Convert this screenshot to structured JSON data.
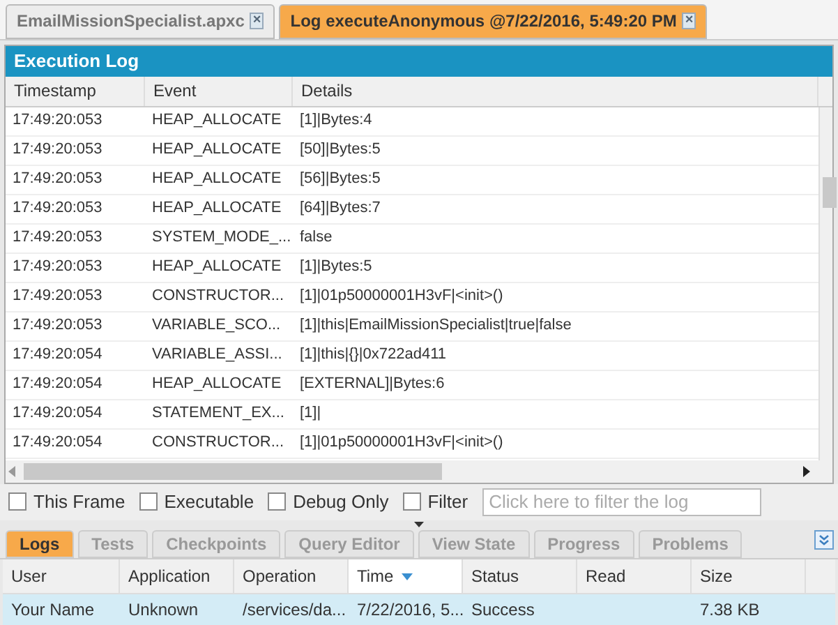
{
  "editor_tabs": [
    {
      "label": "EmailMissionSpecialist.apxc",
      "selected": false,
      "close": "×"
    },
    {
      "label": "Log executeAnonymous @7/22/2016, 5:49:20 PM",
      "selected": true,
      "close": "×"
    }
  ],
  "panel": {
    "title": "Execution Log"
  },
  "log_table": {
    "columns": [
      "Timestamp",
      "Event",
      "Details"
    ],
    "rows": [
      [
        "17:49:20:053",
        "HEAP_ALLOCATE",
        "[1]|Bytes:4"
      ],
      [
        "17:49:20:053",
        "HEAP_ALLOCATE",
        "[50]|Bytes:5"
      ],
      [
        "17:49:20:053",
        "HEAP_ALLOCATE",
        "[56]|Bytes:5"
      ],
      [
        "17:49:20:053",
        "HEAP_ALLOCATE",
        "[64]|Bytes:7"
      ],
      [
        "17:49:20:053",
        "SYSTEM_MODE_...",
        "false"
      ],
      [
        "17:49:20:053",
        "HEAP_ALLOCATE",
        "[1]|Bytes:5"
      ],
      [
        "17:49:20:053",
        "CONSTRUCTOR...",
        "[1]|01p50000001H3vF|<init>()"
      ],
      [
        "17:49:20:053",
        "VARIABLE_SCO...",
        "[1]|this|EmailMissionSpecialist|true|false"
      ],
      [
        "17:49:20:054",
        "VARIABLE_ASSI...",
        "[1]|this|{}|0x722ad411"
      ],
      [
        "17:49:20:054",
        "HEAP_ALLOCATE",
        "[EXTERNAL]|Bytes:6"
      ],
      [
        "17:49:20:054",
        "STATEMENT_EX...",
        "[1]|"
      ],
      [
        "17:49:20:054",
        "CONSTRUCTOR...",
        "[1]|01p50000001H3vF|<init>()"
      ]
    ]
  },
  "filters": [
    {
      "label": "This Frame",
      "checked": false
    },
    {
      "label": "Executable",
      "checked": false
    },
    {
      "label": "Debug Only",
      "checked": false
    },
    {
      "label": "Filter",
      "checked": false
    }
  ],
  "filter_field": {
    "placeholder": "Click here to filter the log"
  },
  "bottom_tabs": [
    {
      "label": "Logs",
      "selected": true
    },
    {
      "label": "Tests",
      "selected": false
    },
    {
      "label": "Checkpoints",
      "selected": false
    },
    {
      "label": "Query Editor",
      "selected": false
    },
    {
      "label": "View State",
      "selected": false
    },
    {
      "label": "Progress",
      "selected": false
    },
    {
      "label": "Problems",
      "selected": false
    }
  ],
  "logs_table": {
    "columns": [
      {
        "label": "User",
        "sorted": false
      },
      {
        "label": "Application",
        "sorted": false
      },
      {
        "label": "Operation",
        "sorted": false
      },
      {
        "label": "Time",
        "sorted": true
      },
      {
        "label": "Status",
        "sorted": false
      },
      {
        "label": "Read",
        "sorted": false
      },
      {
        "label": "Size",
        "sorted": false
      }
    ],
    "rows": [
      {
        "cells": [
          "Your Name",
          "Unknown",
          "/services/da...",
          "7/22/2016, 5...",
          "Success",
          "",
          "7.38 KB"
        ],
        "selected": true
      }
    ]
  }
}
